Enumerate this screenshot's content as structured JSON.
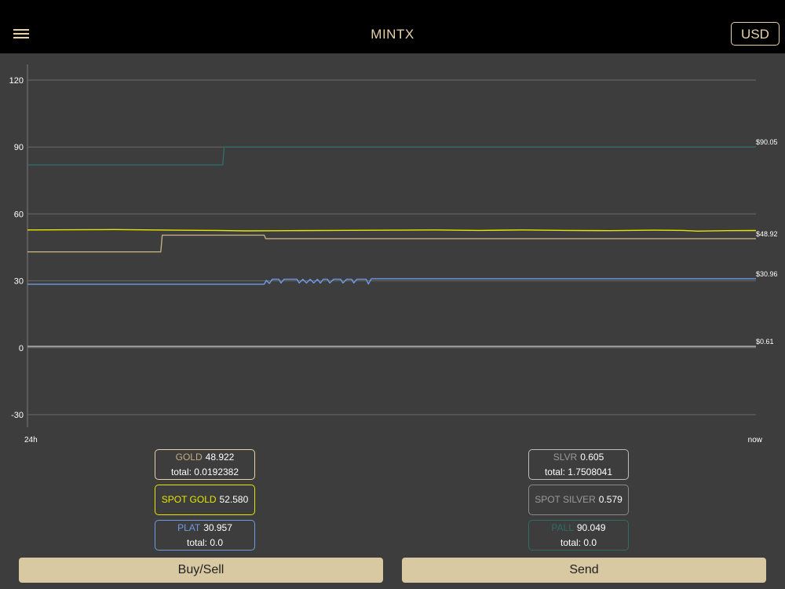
{
  "header": {
    "title": "MINTX",
    "currency": "USD"
  },
  "colors": {
    "gold": "#c2ad80",
    "spot_gold": "#e6e600",
    "silver": "#9a9a9a",
    "plat": "#6f9ae6",
    "pall": "#2e6d65",
    "accent": "#e6d2a8",
    "button": "#d8c9a2"
  },
  "chart_data": {
    "type": "line",
    "title": "",
    "xlabel": "",
    "ylabel": "",
    "ylim": [
      -30,
      120
    ],
    "yticks": [
      -30,
      0,
      30,
      60,
      90,
      120
    ],
    "xlim": [
      0,
      1
    ],
    "xtick_labels": [
      "24h",
      "now"
    ],
    "grid": true,
    "series": [
      {
        "color": "#2e6d65",
        "end_label": "$90.05",
        "points": [
          [
            0,
            82
          ],
          [
            0.268,
            82
          ],
          [
            0.27,
            90.05
          ],
          [
            1,
            90.05
          ]
        ]
      },
      {
        "color": "#e6e600",
        "end_label": "",
        "points": [
          [
            0,
            52.8
          ],
          [
            0.06,
            52.9
          ],
          [
            0.12,
            53.0
          ],
          [
            0.2,
            52.7
          ],
          [
            0.26,
            52.6
          ],
          [
            0.3,
            52.4
          ],
          [
            0.36,
            52.5
          ],
          [
            0.42,
            52.6
          ],
          [
            0.5,
            52.7
          ],
          [
            0.56,
            52.8
          ],
          [
            0.62,
            52.6
          ],
          [
            0.68,
            52.8
          ],
          [
            0.74,
            52.6
          ],
          [
            0.8,
            52.5
          ],
          [
            0.86,
            52.7
          ],
          [
            0.9,
            52.6
          ],
          [
            0.92,
            52.3
          ],
          [
            0.96,
            52.5
          ],
          [
            1,
            52.58
          ]
        ]
      },
      {
        "color": "#c2ad80",
        "end_label": "$48.92",
        "points": [
          [
            0,
            43
          ],
          [
            0.183,
            43
          ],
          [
            0.185,
            50.5
          ],
          [
            0.325,
            50.5
          ],
          [
            0.327,
            48.92
          ],
          [
            1,
            48.92
          ]
        ]
      },
      {
        "color": "#6f9ae6",
        "end_label": "$30.96",
        "points": [
          [
            0,
            28.5
          ],
          [
            0.325,
            28.5
          ],
          [
            0.328,
            30.2
          ],
          [
            0.332,
            28.8
          ],
          [
            0.336,
            30.7
          ],
          [
            0.345,
            30.7
          ],
          [
            0.348,
            29
          ],
          [
            0.352,
            30.7
          ],
          [
            0.37,
            30.7
          ],
          [
            0.373,
            29
          ],
          [
            0.378,
            30.7
          ],
          [
            0.383,
            29
          ],
          [
            0.388,
            30.7
          ],
          [
            0.393,
            29
          ],
          [
            0.398,
            30.7
          ],
          [
            0.402,
            29
          ],
          [
            0.406,
            30.7
          ],
          [
            0.412,
            30.7
          ],
          [
            0.415,
            29
          ],
          [
            0.42,
            30.7
          ],
          [
            0.43,
            30.7
          ],
          [
            0.433,
            29
          ],
          [
            0.438,
            30.7
          ],
          [
            0.445,
            30.7
          ],
          [
            0.448,
            29
          ],
          [
            0.452,
            30.7
          ],
          [
            0.465,
            30.7
          ],
          [
            0.468,
            28.6
          ],
          [
            0.472,
            30.96
          ],
          [
            1,
            30.96
          ]
        ]
      },
      {
        "color": "#9a9a9a",
        "end_label": "$0.61",
        "points": [
          [
            0,
            0.6
          ],
          [
            1,
            0.61
          ]
        ]
      }
    ]
  },
  "metals": {
    "gold": {
      "label": "GOLD",
      "value": "48.922",
      "total": "total: 0.0192382"
    },
    "spot_gold": {
      "label": "SPOT GOLD",
      "value": "52.580"
    },
    "plat": {
      "label": "PLAT",
      "value": "30.957",
      "total": "total: 0.0"
    },
    "slvr": {
      "label": "SLVR",
      "value": "0.605",
      "total": "total: 1.7508041"
    },
    "spot_silver": {
      "label": "SPOT SILVER",
      "value": "0.579"
    },
    "pall": {
      "label": "PALL",
      "value": "90.049",
      "total": "total: 0.0"
    }
  },
  "actions": {
    "buy_sell": "Buy/Sell",
    "send": "Send"
  }
}
